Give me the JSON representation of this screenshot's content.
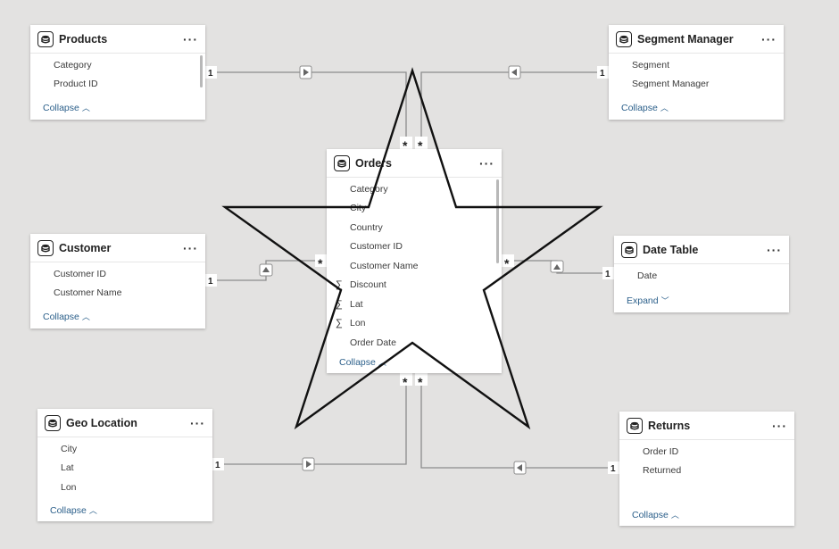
{
  "tables": {
    "products": {
      "title": "Products",
      "fields": [
        "Category",
        "Product ID"
      ],
      "toggle": "Collapse"
    },
    "segment_manager": {
      "title": "Segment Manager",
      "fields": [
        "Segment",
        "Segment Manager"
      ],
      "toggle": "Collapse"
    },
    "orders": {
      "title": "Orders",
      "fields": [
        "Category",
        "City",
        "Country",
        "Customer ID",
        "Customer Name",
        "Discount",
        "Lat",
        "Lon",
        "Order Date"
      ],
      "measure_fields": [
        "Discount",
        "Lat",
        "Lon"
      ],
      "toggle": "Collapse"
    },
    "customer": {
      "title": "Customer",
      "fields": [
        "Customer ID",
        "Customer Name"
      ],
      "toggle": "Collapse"
    },
    "date_table": {
      "title": "Date Table",
      "fields": [
        "Date"
      ],
      "toggle": "Expand"
    },
    "geo_location": {
      "title": "Geo Location",
      "fields": [
        "City",
        "Lat",
        "Lon"
      ],
      "toggle": "Collapse"
    },
    "returns": {
      "title": "Returns",
      "fields": [
        "Order ID",
        "Returned"
      ],
      "toggle": "Collapse"
    }
  },
  "more_label": "···",
  "cardinality": {
    "one": "1",
    "many": "*"
  },
  "icons": {
    "table": "table-icon",
    "sigma": "sigma-icon",
    "chevron_up": "chevron-up-icon",
    "chevron_down": "chevron-down-icon"
  },
  "colors": {
    "canvas": "#e3e2e1",
    "line": "#8c8c8c",
    "link": "#2b5f8a"
  }
}
